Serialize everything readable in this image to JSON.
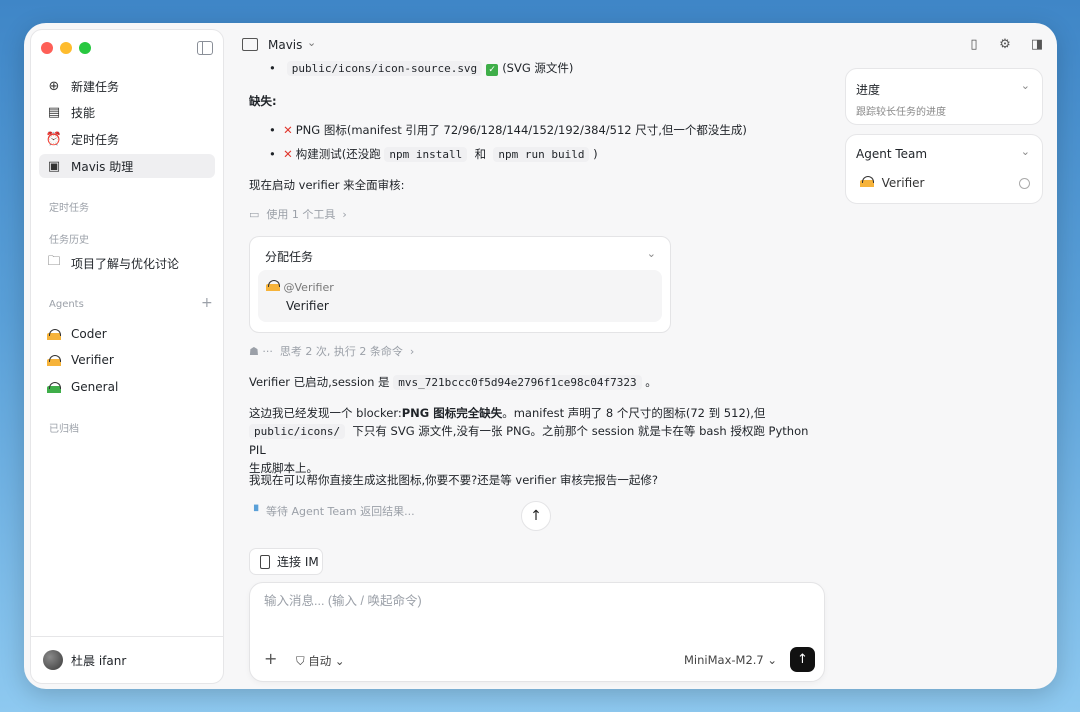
{
  "sidebar": {
    "nav": [
      {
        "label": "新建任务",
        "icon": "plus-circle-icon"
      },
      {
        "label": "技能",
        "icon": "clipboard-icon"
      },
      {
        "label": "定时任务",
        "icon": "alarm-clock-icon"
      },
      {
        "label": "Mavis 助理",
        "icon": "user-square-icon"
      }
    ],
    "scheduled_label": "定时任务",
    "history_label": "任务历史",
    "history_items": [
      "项目了解与优化讨论"
    ],
    "agents_label": "Agents",
    "agents": [
      "Coder",
      "Verifier",
      "General"
    ],
    "archived_label": "已归档",
    "user_name": "杜晨 ifanr"
  },
  "topbar": {
    "project": "Mavis"
  },
  "chat": {
    "line0_code": "public/icons/icon-source.svg",
    "line0_note": "(SVG 源文件)",
    "missing_title": "缺失:",
    "bullet1": "PNG 图标(manifest 引用了 72/96/128/144/152/192/384/512 尺寸,但一个都没生成)",
    "bullet2_a": "构建测试(还没跑",
    "bullet2_code1": "npm install",
    "bullet2_b": "和",
    "bullet2_code2": "npm run build",
    "bullet2_c": ")",
    "verify_start": "现在启动 verifier 来全面审核:",
    "tool_use": "使用 1 个工具",
    "card_title": "分配任务",
    "card_mention": "@Verifier",
    "card_agent": "Verifier",
    "thinking": "思考 2 次, 执行 2 条命令",
    "session_a": "Verifier 已启动,session 是",
    "session_code": "mvs_721bccc0f5d94e2796f1ce98c04f7323",
    "session_b": "。",
    "msg2_a": "这边我已经发现一个 blocker:",
    "msg2_bold": "PNG 图标完全缺失",
    "msg2_b": "。manifest 声明了 8 个尺寸的图标(72 到 512),但",
    "msg2_code": "public/icons/",
    "msg2_c": "下只有 SVG 源文件,没有一张 PNG。之前那个 session 就是卡在等 bash 授权跑 Python PIL",
    "msg2_d": "生成脚本上。",
    "msg3": "我现在可以帮你直接生成这批图标,你要不要?还是等 verifier 审核完报告一起修?",
    "waiting": "等待 Agent Team 返回结果..."
  },
  "im_button": "连接 IM",
  "composer": {
    "placeholder": "输入消息... (输入 / 唤起命令)",
    "mode": "自动",
    "model": "MiniMax-M2.7"
  },
  "right": {
    "progress_title": "进度",
    "progress_sub": "跟踪较长任务的进度",
    "team_title": "Agent Team",
    "team_member": "Verifier"
  }
}
